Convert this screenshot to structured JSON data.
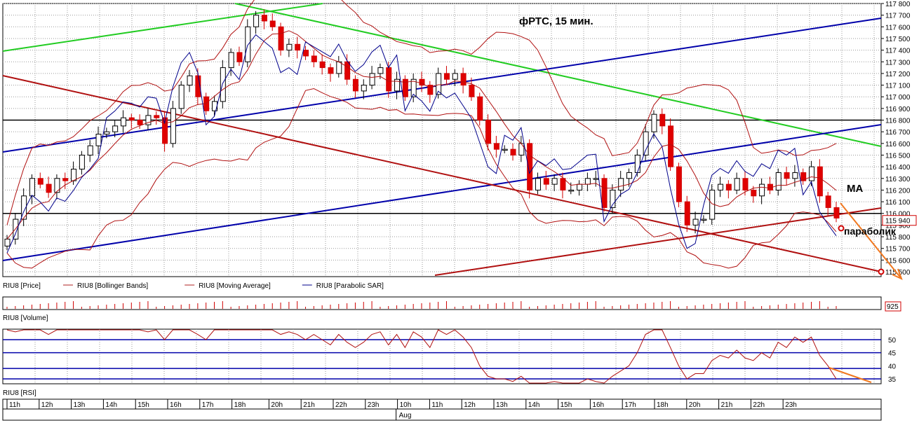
{
  "chart_data": {
    "type": "candlestick",
    "title": "фРТС, 15 мин.",
    "price_pane": {
      "label": "RIU8 [Price]",
      "ylim": [
        115400,
        117800
      ],
      "y_ticks": [
        "117 800",
        "117 700",
        "117 600",
        "117 500",
        "117 400",
        "117 300",
        "117 200",
        "117 100",
        "117 000",
        "116 900",
        "116 800",
        "116 700",
        "116 600",
        "116 500",
        "116 400",
        "116 300",
        "116 200",
        "116 100",
        "116 000",
        "115 900",
        "115 800",
        "115 700",
        "115 600",
        "115 500"
      ],
      "last_price_label": "115 940",
      "legend": [
        {
          "name": "RIU8 [Bollinger Bands]",
          "color": "#b22222"
        },
        {
          "name": "RIU8 [Moving Average]",
          "color": "#b22222"
        },
        {
          "name": "RIU8 [Parabolic SAR]",
          "color": "#00008b"
        }
      ],
      "horizontal_levels": [
        116800,
        116000
      ],
      "annotations": [
        {
          "text": "MA"
        },
        {
          "text": "параболик"
        }
      ],
      "closes": [
        115780,
        115950,
        116150,
        116300,
        116250,
        116180,
        116300,
        116280,
        116380,
        116500,
        116580,
        116680,
        116700,
        116750,
        116820,
        116800,
        116760,
        116840,
        116820,
        116600,
        116900,
        117100,
        117180,
        117000,
        116880,
        116960,
        117250,
        117380,
        117300,
        117600,
        117700,
        117650,
        117600,
        117400,
        117450,
        117400,
        117350,
        117300,
        117250,
        117200,
        117300,
        117150,
        117050,
        117100,
        117200,
        117250,
        117050,
        117150,
        117000,
        117150,
        117100,
        117020,
        117200,
        117150,
        117200,
        117100,
        117000,
        116800,
        116600,
        116550,
        116550,
        116500,
        116600,
        116200,
        116300,
        116250,
        116300,
        116200,
        116200,
        116250,
        116300,
        116300,
        116050,
        116200,
        116300,
        116350,
        116500,
        116700,
        116850,
        116750,
        116400,
        116100,
        115900,
        115950,
        115950,
        116200,
        116250,
        116200,
        116300,
        116200,
        116150,
        116250,
        116200,
        116350,
        116300,
        116350,
        116280,
        116400,
        116150,
        116050,
        115960
      ]
    },
    "volume_pane": {
      "label": "RIU8 [Volume]",
      "last_value_label": "925"
    },
    "rsi_pane": {
      "label": "RIU8 [RSI]",
      "y_ticks": [
        "50",
        "45",
        "40",
        "35"
      ],
      "levels": [
        50,
        45,
        39,
        35
      ],
      "values": [
        55,
        53,
        58,
        60,
        56,
        52,
        55,
        56,
        57,
        60,
        58,
        56,
        55,
        57,
        56,
        54,
        55,
        53,
        54,
        50,
        55,
        57,
        58,
        52,
        50,
        54,
        58,
        60,
        55,
        58,
        60,
        57,
        56,
        52,
        53,
        52,
        50,
        52,
        50,
        48,
        52,
        49,
        47,
        49,
        52,
        53,
        48,
        52,
        47,
        53,
        51,
        47,
        55,
        52,
        55,
        51,
        47,
        40,
        36,
        35,
        35,
        34,
        36,
        30,
        33,
        32,
        34,
        30,
        31,
        33,
        35,
        34,
        31,
        36,
        38,
        40,
        45,
        52,
        58,
        55,
        47,
        40,
        35,
        37,
        37,
        42,
        44,
        43,
        46,
        43,
        42,
        45,
        43,
        49,
        47,
        51,
        49,
        51,
        44,
        40,
        35
      ]
    },
    "time_axis": {
      "labels": [
        "11h",
        "12h",
        "13h",
        "14h",
        "15h",
        "16h",
        "17h",
        "18h",
        "20h",
        "21h",
        "22h",
        "23h",
        "10h",
        "11h",
        "12h",
        "13h",
        "14h",
        "15h",
        "16h",
        "17h",
        "18h",
        "20h",
        "21h",
        "22h",
        "23h"
      ],
      "date_label": "Aug"
    }
  }
}
